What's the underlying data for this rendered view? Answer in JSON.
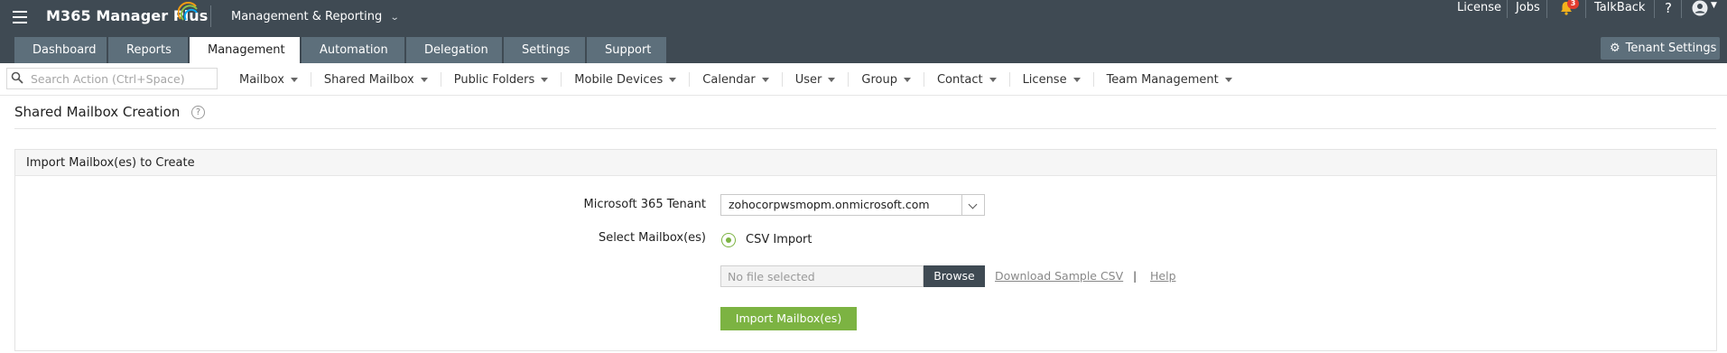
{
  "header": {
    "brand": "M365 Manager Plus",
    "product_switch": "Management & Reporting",
    "links": {
      "license": "License",
      "jobs": "Jobs",
      "talkback": "TalkBack",
      "help": "?"
    },
    "notification_count": "3"
  },
  "tabs": [
    {
      "label": "Dashboard",
      "active": false
    },
    {
      "label": "Reports",
      "active": false
    },
    {
      "label": "Management",
      "active": true
    },
    {
      "label": "Automation",
      "active": false
    },
    {
      "label": "Delegation",
      "active": false
    },
    {
      "label": "Settings",
      "active": false
    },
    {
      "label": "Support",
      "active": false
    }
  ],
  "tenant_settings_label": "Tenant Settings",
  "actionbar": {
    "search_placeholder": "Search Action (Ctrl+Space)",
    "menus": [
      "Mailbox",
      "Shared Mailbox",
      "Public Folders",
      "Mobile Devices",
      "Calendar",
      "User",
      "Group",
      "Contact",
      "License",
      "Team Management"
    ]
  },
  "page": {
    "title": "Shared Mailbox Creation",
    "help_icon": "?"
  },
  "panel": {
    "heading": "Import Mailbox(es) to Create",
    "tenant_label": "Microsoft 365 Tenant",
    "tenant_value": "zohocorpwsmopm.onmicrosoft.com",
    "select_label": "Select Mailbox(es)",
    "radio_label": "CSV Import",
    "file_placeholder": "No file selected",
    "browse_label": "Browse",
    "download_link": "Download Sample CSV",
    "link_separator": "|",
    "help_link": "Help",
    "submit_label": "Import Mailbox(es)"
  },
  "colors": {
    "header_bg": "#3f4a53",
    "tab_bg": "#5d6f7b",
    "accent_green": "#7cb342",
    "badge_red": "#e23b2e"
  }
}
